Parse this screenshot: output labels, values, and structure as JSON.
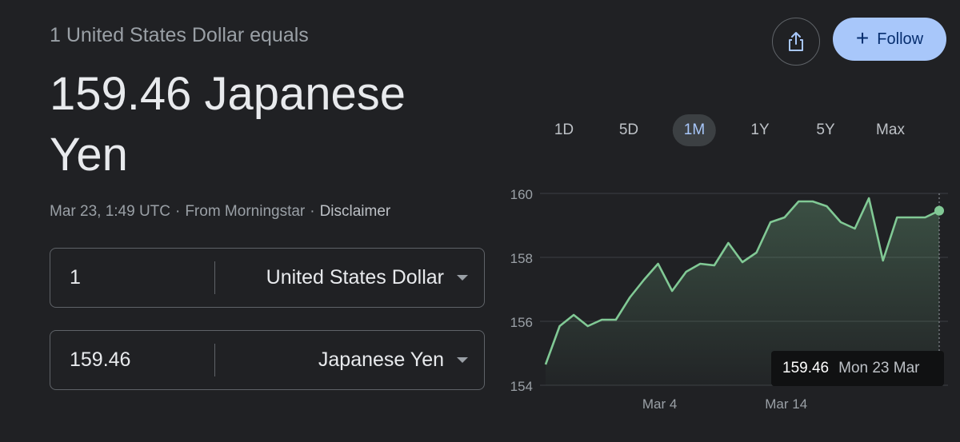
{
  "header": {
    "subtitle": "1 United States Dollar equals",
    "rate_text": "159.46 Japanese Yen",
    "timestamp": "Mar 23, 1:49 UTC",
    "source": "From Morningstar",
    "disclaimer": "Disclaimer",
    "separator": "·"
  },
  "actions": {
    "share_icon": "share-icon",
    "follow_label": "Follow",
    "follow_plus": "+",
    "follow_color": "#a8c7fa"
  },
  "converter": {
    "from": {
      "amount": "1",
      "currency": "United States Dollar"
    },
    "to": {
      "amount": "159.46",
      "currency": "Japanese Yen"
    }
  },
  "ranges": {
    "items": [
      "1D",
      "5D",
      "1M",
      "1Y",
      "5Y",
      "Max"
    ],
    "selected": "1M"
  },
  "tooltip": {
    "value": "159.46",
    "date": "Mon 23 Mar"
  },
  "chart_data": {
    "type": "area",
    "ylim": [
      154,
      160
    ],
    "yticks": [
      "160",
      "158",
      "156",
      "154"
    ],
    "xticks": [
      "Mar 4",
      "Mar 14"
    ],
    "line_color": "#81c995",
    "grid": true,
    "series": [
      {
        "values": [
          154.65,
          155.85,
          156.2,
          155.85,
          156.05,
          156.05,
          156.75,
          157.3,
          157.8,
          156.95,
          157.55,
          157.8,
          157.75,
          158.45,
          157.85,
          158.15,
          159.1,
          159.25,
          159.75,
          159.75,
          159.6,
          159.1,
          158.9,
          159.85,
          157.9,
          159.25,
          159.25,
          159.25,
          159.46
        ]
      }
    ]
  }
}
